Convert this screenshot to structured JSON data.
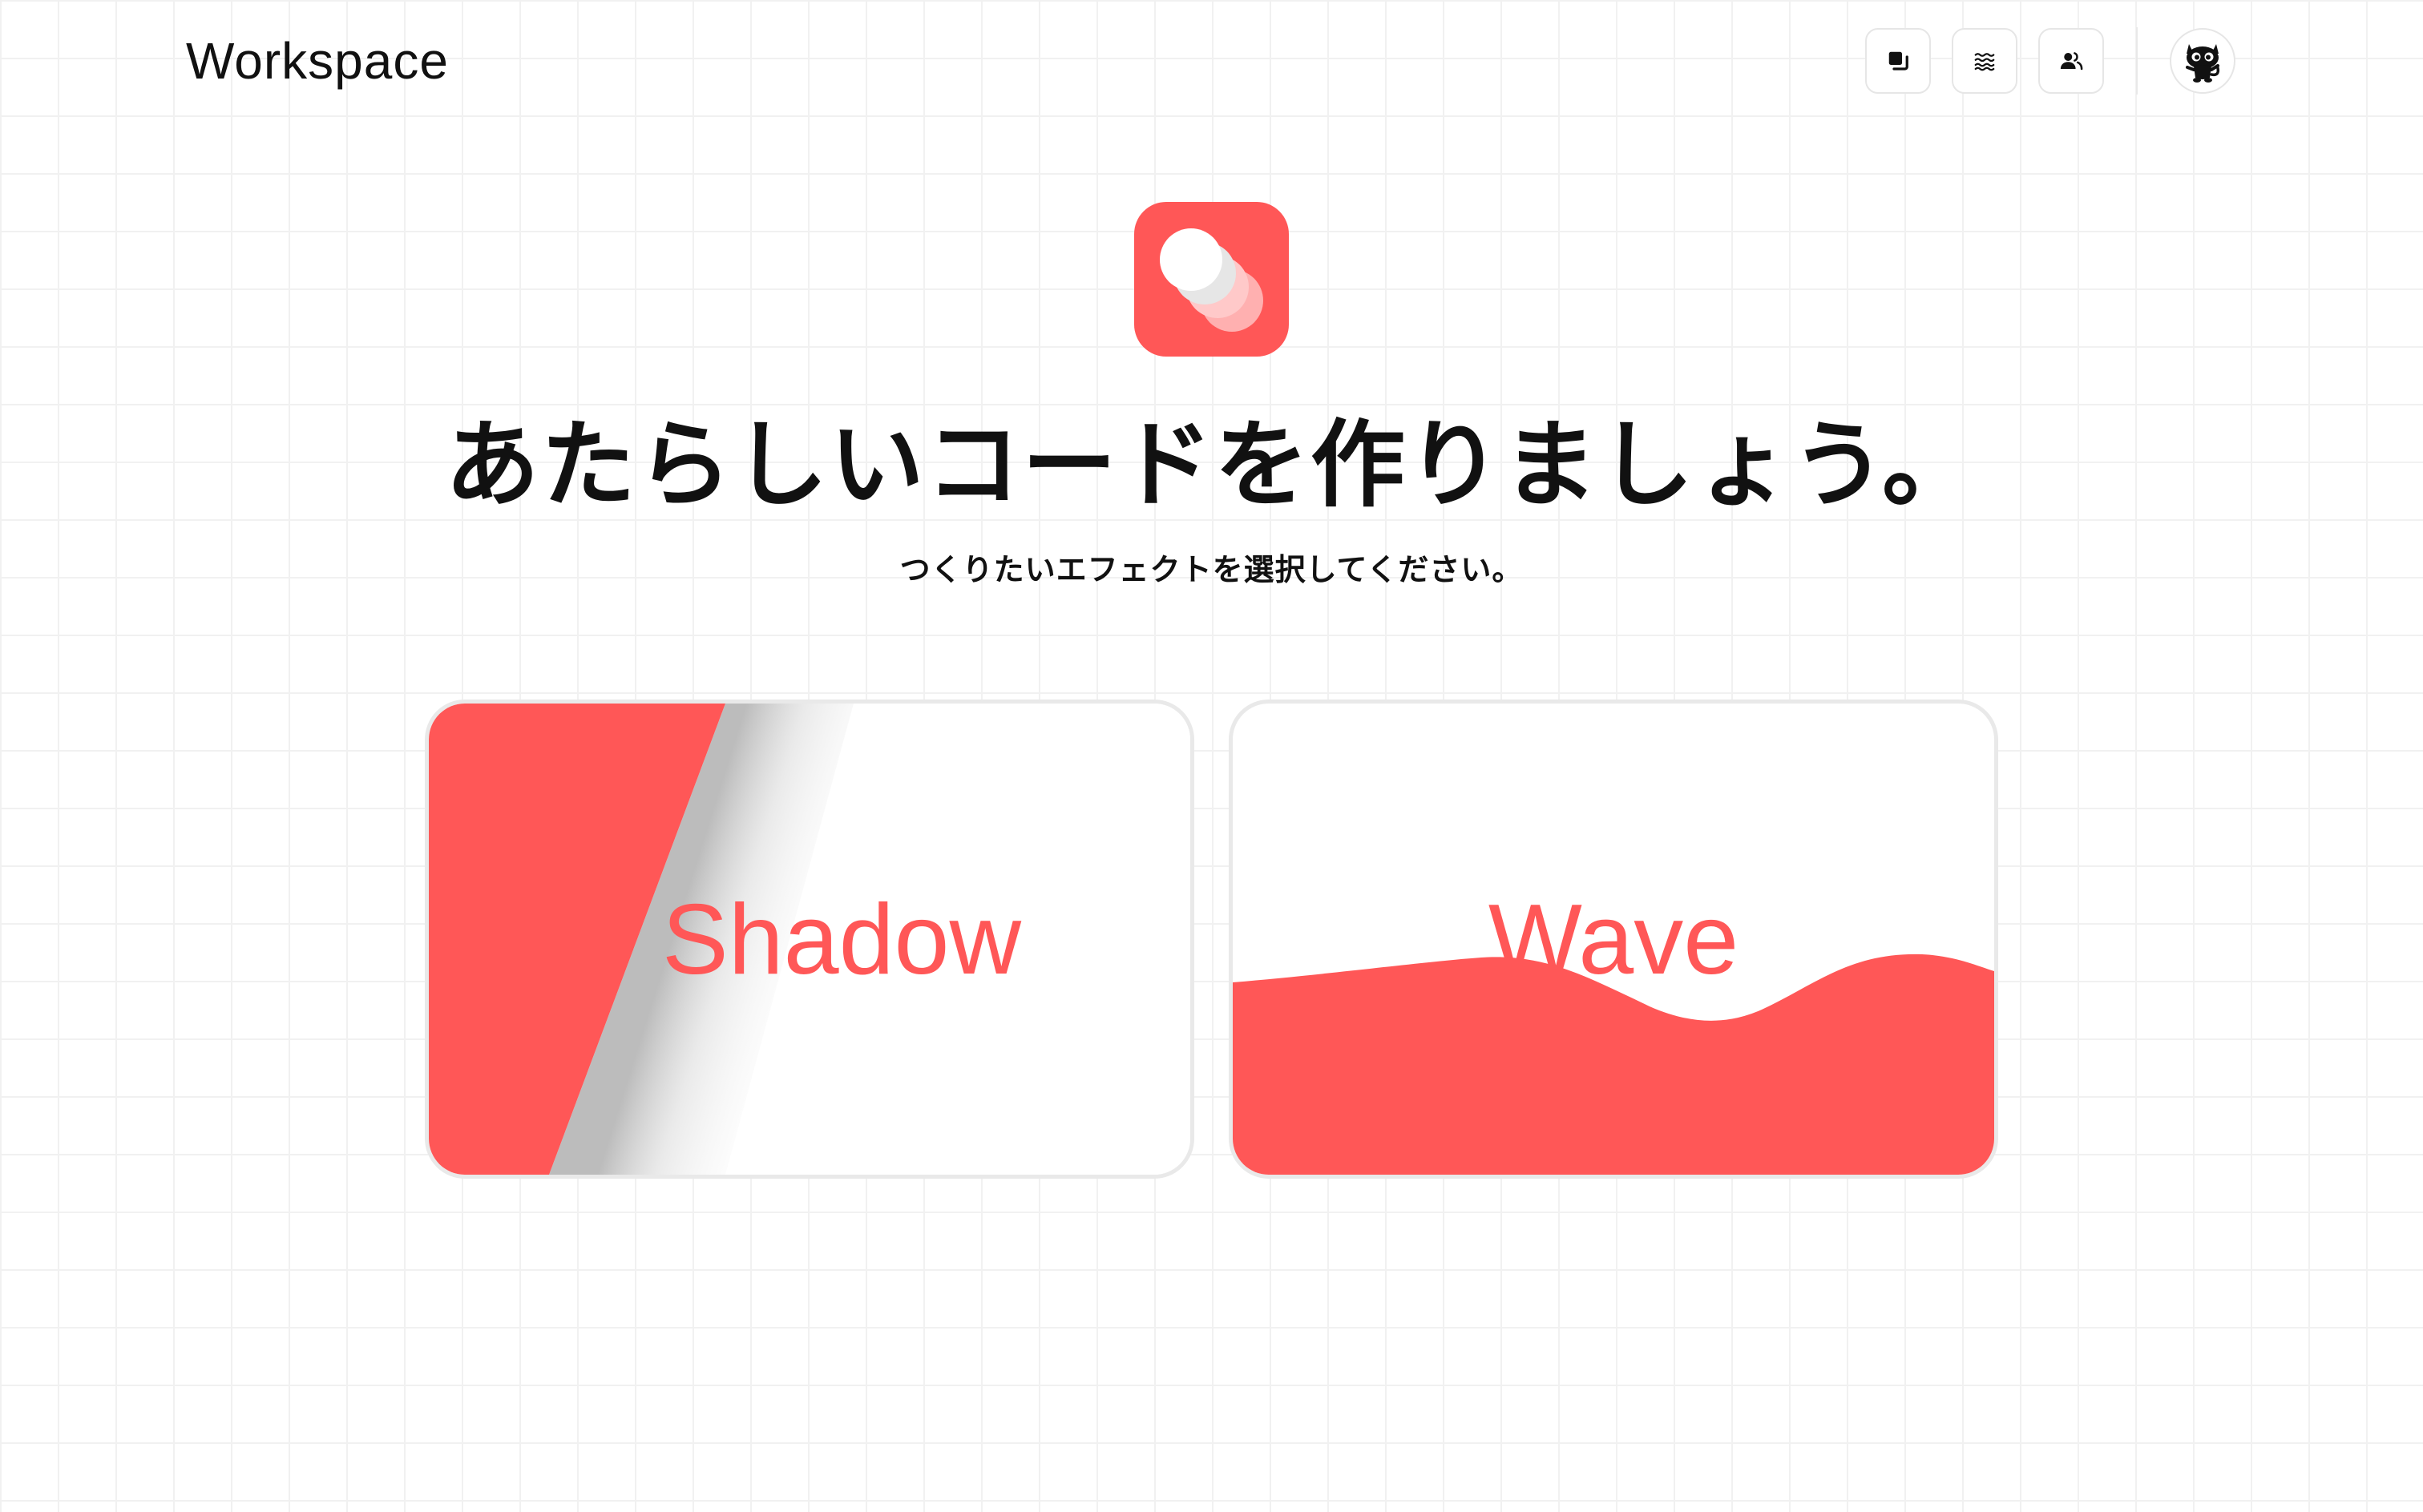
{
  "header": {
    "brand": "Workspace",
    "buttons": [
      {
        "icon": "collection-icon"
      },
      {
        "icon": "waves-icon"
      },
      {
        "icon": "users-icon"
      }
    ],
    "avatar": {
      "icon": "cat-mascot-icon"
    }
  },
  "hero": {
    "logo_icon": "toggle-effect-app-icon",
    "title": "あたらしいコードを作りましょう。",
    "subtitle": "つくりたいエフェクトを選択してください。"
  },
  "effects": [
    {
      "title": "Shadow",
      "preview": "diagonal-shadow"
    },
    {
      "title": "Wave",
      "preview": "wave-fill"
    }
  ],
  "colors": {
    "accent": "#ff5757",
    "border": "#e9e9e9",
    "grid": "#f1f1f1",
    "text": "#111111"
  }
}
